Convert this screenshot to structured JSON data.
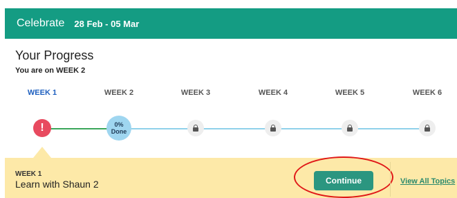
{
  "header": {
    "title": "Celebrate",
    "dates": "28 Feb - 05 Mar",
    "background_color": "#149c83"
  },
  "progress": {
    "title": "Your Progress",
    "subtitle": "You are on WEEK 2",
    "weeks": [
      {
        "label": "WEEK 1",
        "state": "error",
        "icon": "alert-icon",
        "glyph": "!"
      },
      {
        "label": "WEEK 2",
        "state": "current",
        "percent_text": "0%",
        "done_text": "Done"
      },
      {
        "label": "WEEK 3",
        "state": "locked",
        "icon": "lock-icon"
      },
      {
        "label": "WEEK 4",
        "state": "locked",
        "icon": "lock-icon"
      },
      {
        "label": "WEEK 5",
        "state": "locked",
        "icon": "lock-icon"
      },
      {
        "label": "WEEK 6",
        "state": "locked",
        "icon": "lock-icon"
      }
    ],
    "colors": {
      "active_label": "#1e5fbf",
      "error": "#e84a5f",
      "current": "#9fd6f0",
      "completed_line": "#3aa65a",
      "upcoming_line": "#8fd1ea"
    }
  },
  "panel": {
    "week_label": "WEEK 1",
    "topic_title": "Learn with Shaun 2",
    "continue_label": "Continue",
    "view_all_label": "View All Topics",
    "background_color": "#fde9a8",
    "button_color": "#2b9680"
  }
}
